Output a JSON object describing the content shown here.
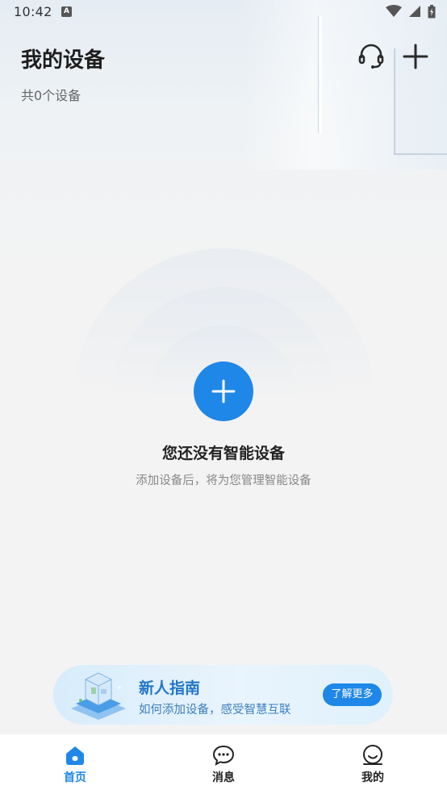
{
  "status_bar": {
    "time": "10:42",
    "notification_icon": "a-notification-icon",
    "icons": [
      "wifi-icon",
      "signal-icon",
      "battery-icon"
    ]
  },
  "header": {
    "title": "我的设备",
    "device_count": "共0个设备",
    "actions": [
      "headset-support-icon",
      "plus-icon"
    ]
  },
  "empty_state": {
    "title": "您还没有智能设备",
    "subtitle": "添加设备后，将为您管理智能设备",
    "add_icon": "plus-icon"
  },
  "guide_banner": {
    "title": "新人指南",
    "subtitle": "如何添加设备，感受智慧互联",
    "button_label": "了解更多"
  },
  "bottom_nav": {
    "items": [
      {
        "label": "首页",
        "icon": "home-icon",
        "active": true
      },
      {
        "label": "消息",
        "icon": "message-icon",
        "active": false
      },
      {
        "label": "我的",
        "icon": "profile-icon",
        "active": false
      }
    ]
  },
  "colors": {
    "accent": "#1f87e8",
    "background": "#f3f3f3",
    "nav_background": "#ffffff"
  }
}
